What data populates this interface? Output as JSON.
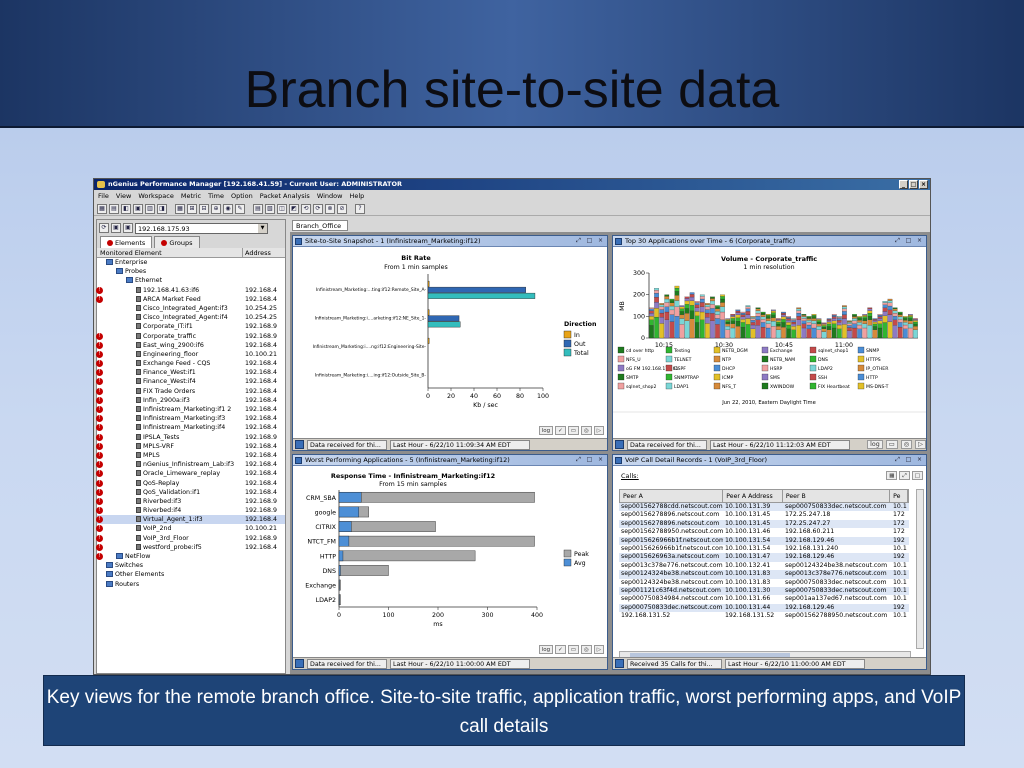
{
  "slide": {
    "title": "Branch site-to-site data",
    "caption": "Key views for the remote branch office.   Site-to-site traffic, application traffic, worst performing apps, and VoIP call details"
  },
  "app": {
    "window_title": "nGenius Performance Manager [192.168.41.59] - Current User: ADMINISTRATOR",
    "menu": [
      "File",
      "View",
      "Workspace",
      "Metric",
      "Time",
      "Option",
      "Packet Analysis",
      "Window",
      "Help"
    ],
    "address_value": "192.168.175.93",
    "tabs": [
      "Elements",
      "Groups"
    ],
    "desktop_tab": "Branch_Office",
    "tree_header": {
      "name": "Monitored Element",
      "address": "Address"
    },
    "tree": [
      {
        "label": "Enterprise",
        "addr": "",
        "indent": 0,
        "alarm": false
      },
      {
        "label": "Probes",
        "addr": "",
        "indent": 1,
        "alarm": false
      },
      {
        "label": "Ethernet",
        "addr": "",
        "indent": 2,
        "alarm": false
      },
      {
        "label": "192.168.41.63:if6",
        "addr": "192.168.4",
        "indent": 3,
        "alarm": true
      },
      {
        "label": "ARCA Market Feed",
        "addr": "192.168.4",
        "indent": 3,
        "alarm": true
      },
      {
        "label": "Cisco_Integrated_Agent:if3",
        "addr": "10.254.25",
        "indent": 3,
        "alarm": false
      },
      {
        "label": "Cisco_Integrated_Agent:if4",
        "addr": "10.254.25",
        "indent": 3,
        "alarm": false
      },
      {
        "label": "Corporate_IT:if1",
        "addr": "192.168.9",
        "indent": 3,
        "alarm": false
      },
      {
        "label": "Corporate_traffic",
        "addr": "192.168.9",
        "indent": 3,
        "alarm": true
      },
      {
        "label": "East_wing_2900:if6",
        "addr": "192.168.4",
        "indent": 3,
        "alarm": true
      },
      {
        "label": "Engineering_floor",
        "addr": "10.100.21",
        "indent": 3,
        "alarm": true
      },
      {
        "label": "Exchange Feed - CQS",
        "addr": "192.168.4",
        "indent": 3,
        "alarm": true
      },
      {
        "label": "Finance_West:if1",
        "addr": "192.168.4",
        "indent": 3,
        "alarm": true
      },
      {
        "label": "Finance_West:if4",
        "addr": "192.168.4",
        "indent": 3,
        "alarm": true
      },
      {
        "label": "FIX Trade Orders",
        "addr": "192.168.4",
        "indent": 3,
        "alarm": true
      },
      {
        "label": "Infin_2900a:if3",
        "addr": "192.168.4",
        "indent": 3,
        "alarm": true
      },
      {
        "label": "Infinistream_Marketing:if1 2",
        "addr": "192.168.4",
        "indent": 3,
        "alarm": true
      },
      {
        "label": "Infinistream_Marketing:if3",
        "addr": "192.168.4",
        "indent": 3,
        "alarm": true
      },
      {
        "label": "Infinistream_Marketing:if4",
        "addr": "192.168.4",
        "indent": 3,
        "alarm": true
      },
      {
        "label": "IPSLA_Tests",
        "addr": "192.168.9",
        "indent": 3,
        "alarm": true
      },
      {
        "label": "MPLS-VRF",
        "addr": "192.168.4",
        "indent": 3,
        "alarm": true
      },
      {
        "label": "MPLS",
        "addr": "192.168.4",
        "indent": 3,
        "alarm": true
      },
      {
        "label": "nGenius_Infinistream_Lab:if3",
        "addr": "192.168.4",
        "indent": 3,
        "alarm": true
      },
      {
        "label": "Oracle_Limeware_replay",
        "addr": "192.168.4",
        "indent": 3,
        "alarm": true
      },
      {
        "label": "QoS-Replay",
        "addr": "192.168.4",
        "indent": 3,
        "alarm": true
      },
      {
        "label": "QoS_Validation:if1",
        "addr": "192.168.4",
        "indent": 3,
        "alarm": true
      },
      {
        "label": "Riverbed:if3",
        "addr": "192.168.9",
        "indent": 3,
        "alarm": true
      },
      {
        "label": "Riverbed:if4",
        "addr": "192.168.9",
        "indent": 3,
        "alarm": true
      },
      {
        "label": "Virtual_Agent_1:if3",
        "addr": "192.168.4",
        "indent": 3,
        "alarm": true,
        "selected": true
      },
      {
        "label": "VoIP_2nd",
        "addr": "10.100.21",
        "indent": 3,
        "alarm": true
      },
      {
        "label": "VoIP_3rd_Floor",
        "addr": "192.168.9",
        "indent": 3,
        "alarm": true
      },
      {
        "label": "westford_probe:if5",
        "addr": "192.168.4",
        "indent": 3,
        "alarm": true
      },
      {
        "label": "NetFlow",
        "addr": "",
        "indent": 1,
        "alarm": true
      },
      {
        "label": "Switches",
        "addr": "",
        "indent": 0,
        "alarm": false
      },
      {
        "label": "Other Elements",
        "addr": "",
        "indent": 0,
        "alarm": false
      },
      {
        "label": "Routers",
        "addr": "",
        "indent": 0,
        "alarm": false
      }
    ],
    "windows": {
      "site": {
        "title": "Site-to-Site Snapshot - 1 (Infinistream_Marketing:if12)",
        "status_msg": "Data received for thi...",
        "status_time": "Last Hour - 6/22/10 11:09:34 AM EDT"
      },
      "top30": {
        "title": "Top 30 Applications over Time - 6 (Corporate_traffic)",
        "status_msg": "Data received for thi...",
        "status_time": "Last Hour - 6/22/10 11:12:03 AM EDT"
      },
      "worst": {
        "title": "Worst Performing Applications - 5 (Infinistream_Marketing:if12)",
        "status_msg": "Data received for thi...",
        "status_time": "Last Hour - 6/22/10 11:00:00 AM EDT"
      },
      "voip": {
        "title": "VoIP Call Detail Records - 1 (VoIP_3rd_Floor)",
        "calls_label": "Calls:",
        "status_msg": "Received 35 Calls for thi...",
        "status_time": "Last Hour - 6/22/10 11:00:00 AM EDT"
      }
    },
    "controls": {
      "log": "log",
      "t1": "✓",
      "t2": "▭",
      "t3": "◎",
      "t4": "▷"
    }
  },
  "chart_data": [
    {
      "type": "bar",
      "orientation": "horizontal",
      "title": "Bit Rate",
      "subtitle": "From 1 min samples",
      "xlabel": "Kb / sec",
      "xlim": [
        0,
        100
      ],
      "xticks": [
        0,
        20,
        40,
        60,
        80,
        100
      ],
      "legend_title": "Direction",
      "categories": [
        "Infinistream_Marketing:...ting:if12:Remote_Site_A-",
        "Infinistream_Marketing:i....arketing:if12:NE_Site_1-",
        "Infinistream_Marketing:i....ng:if12:Engineering-Site-",
        "Infinistream_Marketing:i....ing:if12:Outside_Site_B-"
      ],
      "series": [
        {
          "name": "In",
          "color": "#e8a317",
          "values": [
            1,
            1,
            1,
            0
          ]
        },
        {
          "name": "Out",
          "color": "#2f67b3",
          "values": [
            85,
            27,
            0,
            0
          ]
        },
        {
          "name": "Total",
          "color": "#33bdbd",
          "values": [
            93,
            28,
            0,
            0
          ]
        }
      ]
    },
    {
      "type": "bar",
      "stacked": true,
      "title": "Volume - Corporate_traffic",
      "subtitle": "1 min resolution",
      "ylabel": "MB",
      "ylim": [
        0,
        300
      ],
      "yticks": [
        0,
        100,
        200,
        300
      ],
      "xticks": [
        "10:15",
        "10:30",
        "10:45",
        "11:00"
      ],
      "footer": "Jun 22, 2010, Eastern Daylight Time",
      "values_total": [
        140,
        230,
        160,
        200,
        180,
        240,
        150,
        190,
        210,
        170,
        200,
        160,
        190,
        150,
        200,
        90,
        110,
        130,
        120,
        150,
        100,
        140,
        120,
        110,
        130,
        90,
        120,
        100,
        90,
        140,
        110,
        100,
        110,
        90,
        70,
        90,
        110,
        100,
        150,
        80,
        110,
        100,
        110,
        140,
        90,
        110,
        170,
        180,
        140,
        120,
        100,
        110,
        90
      ],
      "legend": [
        "cd over http",
        "Testing",
        "NETB_DGM",
        "Exchange",
        "sqlnet_shop1",
        "SNMP",
        "NFS_U",
        "TELNET",
        "NTP",
        "NETB_NAM",
        "DNS",
        "HTTPS",
        "oG FM 192.168.176.61",
        "OSPF",
        "DHCP",
        "HSRP",
        "LDAP2",
        "IP_OTHER",
        "SMTP",
        "SNMPTRAP",
        "ICMP",
        "SMS",
        "SSH",
        "HTTP",
        "sqlnet_shop2",
        "LDAP1",
        "NFS_T",
        "XWINDOW",
        "FIX Heartbeat",
        "MS-DNS-T"
      ]
    },
    {
      "type": "bar",
      "orientation": "horizontal",
      "title": "Response Time - Infinistream_Marketing:if12",
      "subtitle": "From 15 min samples",
      "xlabel": "ms",
      "xlim": [
        0,
        400
      ],
      "xticks": [
        0,
        100,
        200,
        300,
        400
      ],
      "categories": [
        "CRM_SBA",
        "google",
        "CITRIX",
        "NTCT_FM",
        "HTTP",
        "DNS",
        "Exchange",
        "LDAP2"
      ],
      "series": [
        {
          "name": "Peak",
          "color": "#a8a8a8",
          "values": [
            395,
            60,
            195,
            395,
            275,
            100,
            3,
            3
          ]
        },
        {
          "name": "Avg",
          "color": "#4d8fd6",
          "values": [
            45,
            40,
            25,
            20,
            8,
            3,
            1,
            1
          ]
        }
      ]
    }
  ],
  "voip_table": {
    "headers": [
      "Peer A",
      "Peer A Address",
      "Peer B",
      "Pe"
    ],
    "rows": [
      [
        "sep001562788cdd.netscout.com",
        "10.100.131.39",
        "sep000750833dec.netscout.com",
        "10.1"
      ],
      [
        "sep00156278896.netscout.com",
        "10.100.131.45",
        "172.25.247.18",
        "172"
      ],
      [
        "sep00156278896.netscout.com",
        "10.100.131.45",
        "172.25.247.27",
        "172"
      ],
      [
        "sep001562788950.netscout.com",
        "10.100.131.46",
        "192.168.60.211",
        "172"
      ],
      [
        "sep0015626966b1f.netscout.com",
        "10.100.131.54",
        "192.168.129.46",
        "192"
      ],
      [
        "sep0015626966b1f.netscout.com",
        "10.100.131.54",
        "192.168.131.240",
        "10.1"
      ],
      [
        "sep0015626963a.netscout.com",
        "10.100.131.47",
        "192.168.129.46",
        "192"
      ],
      [
        "sep0013c378e776.netscout.com",
        "10.100.132.41",
        "sep00124324be38.netscout.com",
        "10.1"
      ],
      [
        "sep00124324be38.netscout.com",
        "10.100.131.83",
        "sep0013c378e776.netscout.com",
        "10.1"
      ],
      [
        "sep00124324be38.netscout.com",
        "10.100.131.83",
        "sep000750833dec.netscout.com",
        "10.1"
      ],
      [
        "sep001121c63f4d.netscout.com",
        "10.100.131.30",
        "sep000750833dec.netscout.com",
        "10.1"
      ],
      [
        "sep000750834984.netscout.com",
        "10.100.131.66",
        "sep001aa137ed67.netscout.com",
        "10.1"
      ],
      [
        "sep000750833dec.netscout.com",
        "10.100.131.44",
        "192.168.129.46",
        "192"
      ],
      [
        "192.168.131.52",
        "192.168.131.52",
        "sep001562788950.netscout.com",
        "10.1"
      ]
    ]
  }
}
